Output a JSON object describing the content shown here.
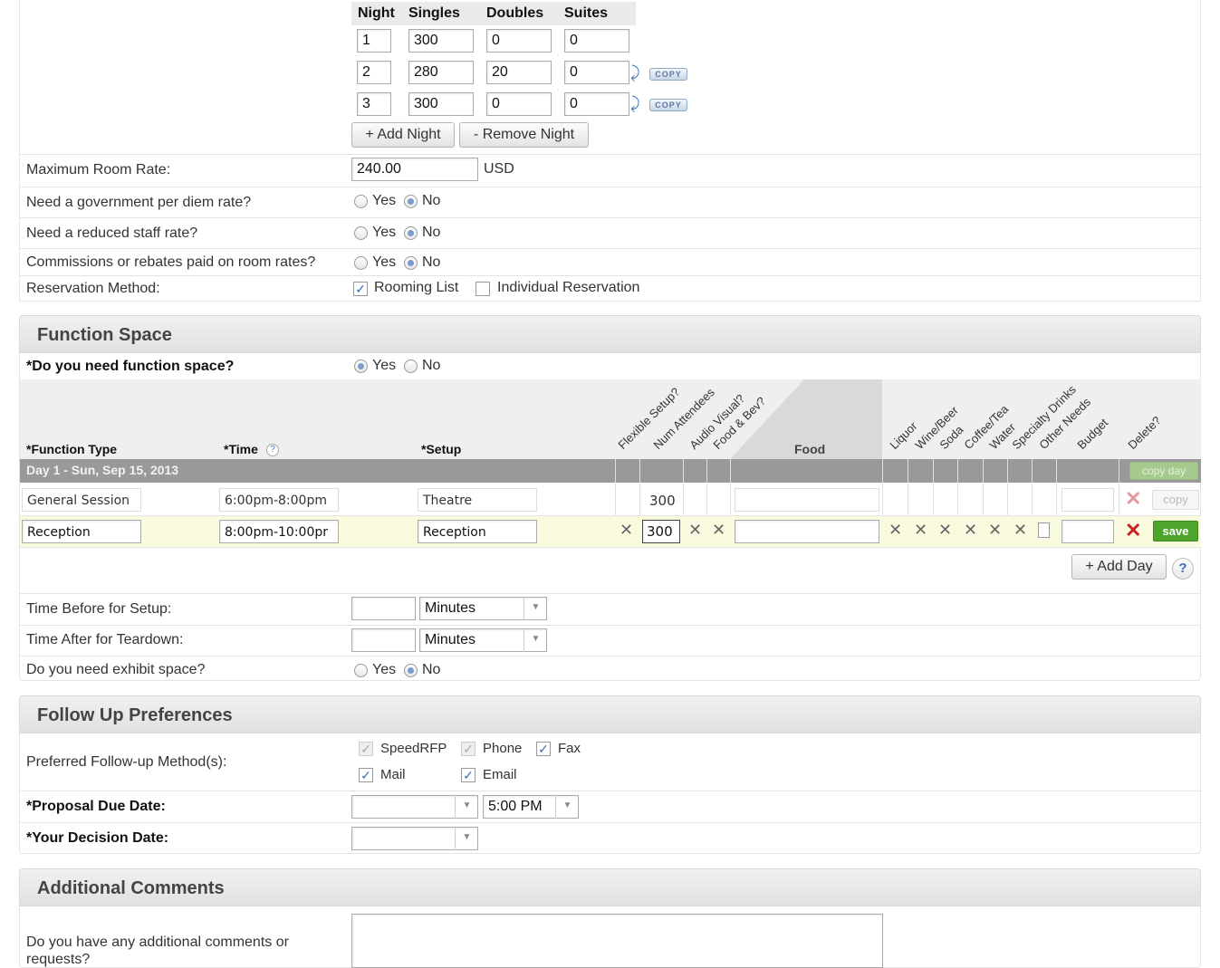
{
  "rooms": {
    "headers": [
      "Night",
      "Singles",
      "Doubles",
      "Suites"
    ],
    "rows": [
      {
        "night": "1",
        "singles": "300",
        "doubles": "0",
        "suites": "0"
      },
      {
        "night": "2",
        "singles": "280",
        "doubles": "20",
        "suites": "0"
      },
      {
        "night": "3",
        "singles": "300",
        "doubles": "0",
        "suites": "0"
      }
    ],
    "copy_label": "COPY",
    "add_night": "+ Add Night",
    "remove_night": "- Remove Night"
  },
  "max_rate": {
    "label": "Maximum Room Rate:",
    "value": "240.00",
    "unit": "USD"
  },
  "yes_label": "Yes",
  "no_label": "No",
  "questions": {
    "per_diem": "Need a government per diem rate?",
    "staff_rate": "Need a reduced staff rate?",
    "commissions": "Commissions or rebates paid on room rates?",
    "reservation": "Reservation Method:",
    "rooming_list": "Rooming List",
    "individual": "Individual Reservation"
  },
  "function_space": {
    "title": "Function Space",
    "need_label": "*Do you need function space?",
    "col_function_type": "*Function Type",
    "col_time": "*Time",
    "time_help": "?",
    "col_setup": "*Setup",
    "col_food": "Food",
    "diag_headers": {
      "flexible": "Flexible Setup?",
      "num_attendees": "Num Attendees",
      "audio_visual": "Audio Visual?",
      "food_bev": "Food & Bev?",
      "liquor": "Liquor",
      "wine_beer": "Wine/Beer",
      "soda": "Soda",
      "coffee_tea": "Coffee/Tea",
      "water": "Water",
      "specialty": "Specialty Drinks",
      "other_needs": "Other Needs",
      "budget": "Budget",
      "delete": "Delete?"
    },
    "day_label": "Day 1 - Sun, Sep 15, 2013",
    "copy_day": "copy day",
    "row1": {
      "type": "General Session",
      "time": "6:00pm-8:00pm",
      "setup": "Theatre",
      "attendees": "300",
      "copy": "copy"
    },
    "row2": {
      "type": "Reception",
      "time": "8:00pm-10:00pr",
      "setup": "Reception",
      "attendees": "300",
      "save": "save"
    },
    "add_day": "+ Add Day",
    "help": "?",
    "setup_time_label": "Time Before for Setup:",
    "teardown_label": "Time After for Teardown:",
    "minutes": "Minutes",
    "exhibit_label": "Do you need exhibit space?"
  },
  "followup": {
    "title": "Follow Up Preferences",
    "method_label": "Preferred Follow-up Method(s):",
    "speedrfp": "SpeedRFP",
    "phone": "Phone",
    "fax": "Fax",
    "mail": "Mail",
    "email": "Email",
    "proposal_label": "*Proposal Due Date:",
    "proposal_time": "5:00 PM",
    "decision_label": "*Your Decision Date:"
  },
  "comments": {
    "title": "Additional Comments",
    "question": "Do you have any additional comments or requests?"
  },
  "colors": {
    "highlight_row": "#fafadf",
    "day_bar": "#999999",
    "save_green": "#4da62b",
    "delete_red": "#cc2222"
  }
}
